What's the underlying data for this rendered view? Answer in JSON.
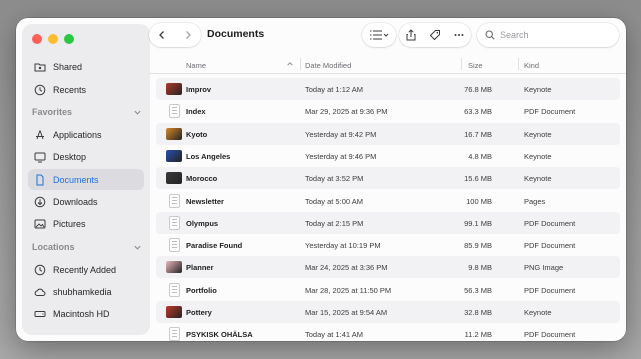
{
  "window": {
    "title": "Documents"
  },
  "sidebar": {
    "items_top": [
      {
        "label": "Shared",
        "icon": "shared-folder-icon"
      },
      {
        "label": "Recents",
        "icon": "clock-icon"
      }
    ],
    "favorites_header": "Favorites",
    "favorites": [
      {
        "label": "Applications",
        "icon": "applications-icon"
      },
      {
        "label": "Desktop",
        "icon": "desktop-icon"
      },
      {
        "label": "Documents",
        "icon": "document-icon",
        "selected": true
      },
      {
        "label": "Downloads",
        "icon": "download-icon"
      },
      {
        "label": "Pictures",
        "icon": "pictures-icon"
      }
    ],
    "locations_header": "Locations",
    "locations": [
      {
        "label": "Recently Added",
        "icon": "clock-icon"
      },
      {
        "label": "shubhamkedia",
        "icon": "cloud-icon"
      },
      {
        "label": "Macintosh HD",
        "icon": "drive-icon"
      }
    ]
  },
  "toolbar": {
    "search_placeholder": "Search"
  },
  "table": {
    "columns": {
      "name": "Name",
      "date": "Date Modified",
      "size": "Size",
      "kind": "Kind"
    },
    "rows": [
      {
        "name": "Improv",
        "date": "Today at 1:12 AM",
        "size": "76.8 MB",
        "kind": "Keynote",
        "thumb": "keynote",
        "color": "#b03a2e"
      },
      {
        "name": "Index",
        "date": "Mar 29, 2025 at 9:36 PM",
        "size": "63.3 MB",
        "kind": "PDF Document",
        "thumb": "doc",
        "color": "#ffffff"
      },
      {
        "name": "Kyoto",
        "date": "Yesterday at 9:42 PM",
        "size": "16.7 MB",
        "kind": "Keynote",
        "thumb": "keynote",
        "color": "#d98a2b"
      },
      {
        "name": "Los Angeles",
        "date": "Yesterday at 9:46 PM",
        "size": "4.8 MB",
        "kind": "Keynote",
        "thumb": "keynote",
        "color": "#2b4fb0"
      },
      {
        "name": "Morocco",
        "date": "Today at 3:52 PM",
        "size": "15.6 MB",
        "kind": "Keynote",
        "thumb": "keynote",
        "color": "#3a3a3a"
      },
      {
        "name": "Newsletter",
        "date": "Today at 5:00 AM",
        "size": "100 MB",
        "kind": "Pages",
        "thumb": "doc",
        "color": "#ffffff"
      },
      {
        "name": "Olympus",
        "date": "Today at 2:15 PM",
        "size": "99.1 MB",
        "kind": "PDF Document",
        "thumb": "doc",
        "color": "#ffffff"
      },
      {
        "name": "Paradise Found",
        "date": "Yesterday at 10:19 PM",
        "size": "85.9 MB",
        "kind": "PDF Document",
        "thumb": "doc",
        "color": "#ffffff"
      },
      {
        "name": "Planner",
        "date": "Mar 24, 2025 at 3:36 PM",
        "size": "9.8 MB",
        "kind": "PNG Image",
        "thumb": "image",
        "color": "#e9b9bd"
      },
      {
        "name": "Portfolio",
        "date": "Mar 28, 2025 at 11:50 PM",
        "size": "56.3 MB",
        "kind": "PDF Document",
        "thumb": "doc",
        "color": "#ffffff"
      },
      {
        "name": "Pottery",
        "date": "Mar 15, 2025 at 9:54 AM",
        "size": "32.8 MB",
        "kind": "Keynote",
        "thumb": "keynote",
        "color": "#c0392b"
      },
      {
        "name": "PSYKISK OHÄLSA",
        "date": "Today at 1:41 AM",
        "size": "11.2 MB",
        "kind": "PDF Document",
        "thumb": "doc",
        "color": "#ffffff"
      }
    ]
  }
}
